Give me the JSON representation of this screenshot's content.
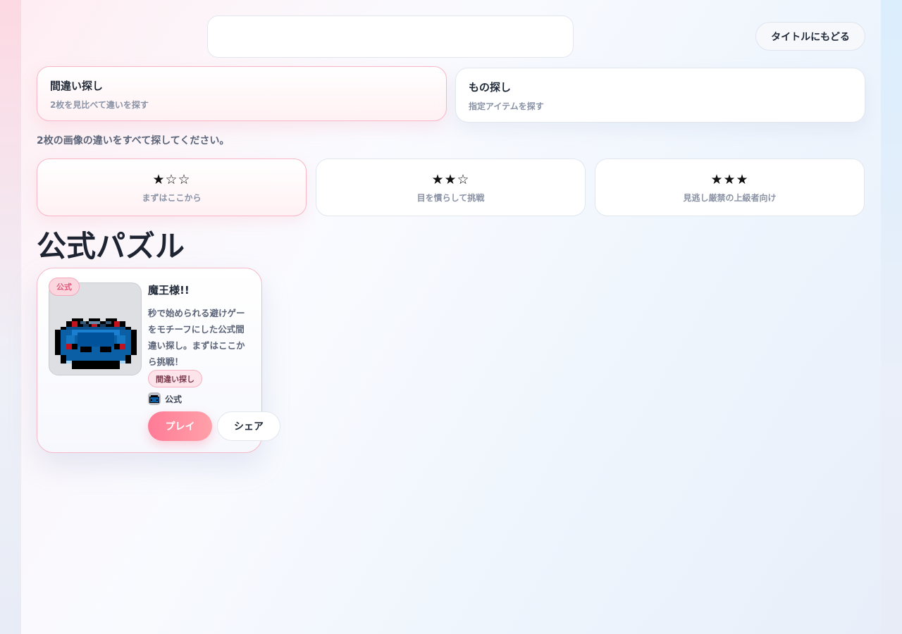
{
  "header": {
    "search_value": "",
    "back_label": "タイトルにもどる"
  },
  "modes": [
    {
      "title": "間違い探し",
      "subtitle": "2枚を見比べて違いを探す",
      "selected": true
    },
    {
      "title": "もの探し",
      "subtitle": "指定アイテムを探す",
      "selected": false
    }
  ],
  "instruction": "2枚の画像の違いをすべて探してください。",
  "difficulties": [
    {
      "stars": "★☆☆",
      "label": "まずはここから",
      "selected": true
    },
    {
      "stars": "★★☆",
      "label": "目を慣らして挑戦",
      "selected": false
    },
    {
      "stars": "★★★",
      "label": "見逃し厳禁の上級者向け",
      "selected": false
    }
  ],
  "section_title": "公式パズル",
  "puzzles": [
    {
      "badge": "公式",
      "title": "魔王様!!",
      "description": "秒で始められる避けゲーをモチーフにした公式間違い探し。まずはここから挑戦！",
      "tag": "間違い探し",
      "author": "公式",
      "play_label": "プレイ",
      "share_label": "シェア",
      "thumbnail_icon": "pixel-demon-king-icon"
    }
  ],
  "colors": {
    "accent_pink": "#ff7b96",
    "border_pink": "#f8b6c6",
    "text_dark": "#1f2937",
    "text_muted": "#8a93a6"
  }
}
